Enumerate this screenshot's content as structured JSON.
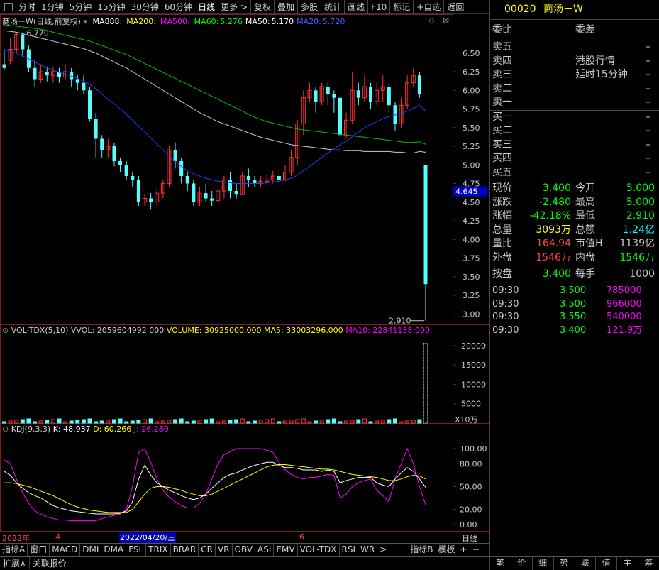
{
  "toolbar": {
    "items": [
      "分时",
      "1分钟",
      "5分钟",
      "15分钟",
      "30分钟",
      "60分钟",
      "日线",
      "更多 >",
      "复权",
      "叠加",
      "多股",
      "统计",
      "画线",
      "F10",
      "标记",
      "+自选",
      "返回"
    ],
    "active": "日线"
  },
  "main_chart": {
    "stock_label": "商汤－W",
    "adj_label": "(日线,前复权)",
    "ma": [
      {
        "name": "MA888:",
        "value": "",
        "color": "#ffffff"
      },
      {
        "name": "MA200:",
        "value": "",
        "color": "#ffff00"
      },
      {
        "name": "MA500:",
        "value": "",
        "color": "#ff00ff"
      },
      {
        "name": "MA60:",
        "value": "5.276",
        "color": "#00ff00"
      },
      {
        "name": "MA50:",
        "value": "5.170",
        "color": "#ffffff"
      },
      {
        "name": "MA20:",
        "value": "5.720",
        "color": "#4060ff"
      }
    ],
    "high_label": "6.770",
    "low_label": "2.910",
    "cur_label": "4.645",
    "y_ticks": [
      "6.50",
      "6.25",
      "6.00",
      "5.75",
      "5.50",
      "5.25",
      "5.00",
      "4.75",
      "4.50",
      "4.25",
      "4.00",
      "3.75",
      "3.50",
      "3.25",
      "3.00"
    ]
  },
  "volume": {
    "legend_name": "VOL-TDX(5,10)",
    "vvol": "VVOL: 2059604992.000",
    "volume": "VOLUME: 30925000.000",
    "ma5": "MA5: 33003296.000",
    "ma10": "MA10: 22841138.000",
    "y_ticks": [
      "20000",
      "15000",
      "10000",
      "5000"
    ],
    "unit": "X10万"
  },
  "kdj": {
    "name": "KDJ(9,3,3)",
    "k": "K: 48.937",
    "d": "D: 60.266",
    "j": "J: 26.280",
    "y_ticks": [
      "100.00",
      "80.00",
      "50.00",
      "20.00",
      "0.00"
    ]
  },
  "x_axis": {
    "labels": [
      "2022年",
      "4",
      "2022/04/20/三",
      "6"
    ],
    "period": "日线"
  },
  "tabs": [
    "指标A",
    "窗口",
    "MACD",
    "DMI",
    "DMA",
    "FSL",
    "TRIX",
    "BRAR",
    "CR",
    "VR",
    "OBV",
    "ASI",
    "EMV",
    "VOL-TDX",
    "RSI",
    "WR",
    ">",
    "指标B",
    "模板",
    "+",
    "−"
  ],
  "status": [
    "扩展∧",
    "关联报价"
  ],
  "right_panel": {
    "code": "00020",
    "name": "商汤－W",
    "weibi_label": "委比",
    "weicha_label": "委差",
    "sell": [
      {
        "label": "卖五",
        "value": "–"
      },
      {
        "label": "卖四",
        "value": "–",
        "note": "港股行情"
      },
      {
        "label": "卖三",
        "value": "–",
        "note": "延时15分钟"
      },
      {
        "label": "卖二",
        "value": "–"
      },
      {
        "label": "卖一",
        "value": "–"
      }
    ],
    "buy": [
      {
        "label": "买一",
        "value": "–"
      },
      {
        "label": "买二",
        "value": "–"
      },
      {
        "label": "买三",
        "value": "–"
      },
      {
        "label": "买四",
        "value": "–"
      },
      {
        "label": "买五",
        "value": "–"
      }
    ],
    "quote": [
      {
        "k1": "现价",
        "v1": "3.400",
        "c1": "#00ff00",
        "k2": "今开",
        "v2": "5.000",
        "c2": "#00ff00"
      },
      {
        "k1": "涨跌",
        "v1": "-2.480",
        "c1": "#00ff00",
        "k2": "最高",
        "v2": "5.000",
        "c2": "#00ff00"
      },
      {
        "k1": "涨幅",
        "v1": "-42.18%",
        "c1": "#00ff00",
        "k2": "最低",
        "v2": "2.910",
        "c2": "#00ff00"
      },
      {
        "k1": "总量",
        "v1": "3093万",
        "c1": "#ffff00",
        "k2": "总额",
        "v2": "1.24亿",
        "c2": "#00ffff"
      },
      {
        "k1": "量比",
        "v1": "164.94",
        "c1": "#ff4040",
        "k2": "市值H",
        "v2": "1139亿",
        "c2": "#c8c8c8"
      },
      {
        "k1": "外盘",
        "v1": "1546万",
        "c1": "#ff4040",
        "k2": "内盘",
        "v2": "1546万",
        "c2": "#00ff00"
      }
    ],
    "anpan": {
      "k1": "按盘",
      "v1": "3.400",
      "k2": "每手",
      "v2": "1000"
    },
    "trades": [
      {
        "time": "09:30",
        "price": "3.500",
        "vol": "785000"
      },
      {
        "time": "09:30",
        "price": "3.500",
        "vol": "966000"
      },
      {
        "time": "09:30",
        "price": "3.550",
        "vol": "540000"
      },
      {
        "time": "09:30",
        "price": "3.400",
        "vol": "121.9万"
      }
    ],
    "bottom_tabs": [
      "笔",
      "价",
      "细",
      "势",
      "联",
      "值",
      "主",
      "筹"
    ]
  },
  "chart_data": {
    "type": "candlestick",
    "ylim": [
      2.85,
      6.85
    ],
    "candles": [
      [
        6.35,
        6.3,
        6.55,
        6.28
      ],
      [
        6.4,
        6.55,
        6.7,
        6.35
      ],
      [
        6.55,
        6.75,
        6.77,
        6.5
      ],
      [
        6.75,
        6.55,
        6.77,
        6.45
      ],
      [
        6.55,
        6.3,
        6.6,
        6.25
      ],
      [
        6.3,
        6.15,
        6.4,
        6.05
      ],
      [
        6.15,
        6.25,
        6.35,
        6.1
      ],
      [
        6.25,
        6.2,
        6.32,
        6.12
      ],
      [
        6.2,
        6.25,
        6.32,
        6.1
      ],
      [
        6.25,
        6.18,
        6.3,
        6.1
      ],
      [
        6.18,
        6.25,
        6.35,
        6.15
      ],
      [
        6.25,
        6.15,
        6.3,
        6.05
      ],
      [
        6.15,
        6.1,
        6.2,
        6.0
      ],
      [
        6.1,
        6.0,
        6.2,
        5.95
      ],
      [
        6.0,
        5.62,
        6.05,
        5.58
      ],
      [
        5.62,
        5.35,
        5.7,
        5.1
      ],
      [
        5.35,
        5.2,
        5.4,
        5.1
      ],
      [
        5.2,
        5.25,
        5.35,
        5.1
      ],
      [
        5.25,
        5.05,
        5.3,
        4.98
      ],
      [
        5.05,
        5.0,
        5.1,
        4.9
      ],
      [
        5.0,
        4.85,
        5.05,
        4.8
      ],
      [
        4.85,
        4.8,
        4.9,
        4.7
      ],
      [
        4.8,
        4.5,
        4.85,
        4.45
      ],
      [
        4.5,
        4.55,
        4.6,
        4.45
      ],
      [
        4.55,
        4.5,
        4.62,
        4.4
      ],
      [
        4.5,
        4.62,
        4.7,
        4.45
      ],
      [
        4.62,
        4.75,
        4.8,
        4.55
      ],
      [
        4.75,
        5.2,
        5.25,
        4.7
      ],
      [
        5.2,
        5.05,
        5.3,
        4.95
      ],
      [
        5.05,
        4.85,
        5.1,
        4.75
      ],
      [
        4.85,
        4.75,
        4.9,
        4.65
      ],
      [
        4.75,
        4.5,
        4.8,
        4.45
      ],
      [
        4.5,
        4.62,
        4.7,
        4.45
      ],
      [
        4.62,
        4.55,
        4.75,
        4.5
      ],
      [
        4.55,
        4.52,
        4.65,
        4.45
      ],
      [
        4.52,
        4.65,
        4.72,
        4.5
      ],
      [
        4.65,
        4.8,
        4.85,
        4.55
      ],
      [
        4.8,
        4.65,
        4.9,
        4.55
      ],
      [
        4.65,
        4.6,
        4.75,
        4.55
      ],
      [
        4.6,
        4.85,
        4.9,
        4.6
      ],
      [
        4.85,
        4.8,
        4.95,
        4.7
      ],
      [
        4.8,
        4.75,
        4.85,
        4.7
      ],
      [
        4.75,
        4.78,
        4.85,
        4.7
      ],
      [
        4.78,
        4.8,
        4.88,
        4.72
      ],
      [
        4.8,
        4.85,
        4.92,
        4.75
      ],
      [
        4.85,
        4.8,
        4.95,
        4.75
      ],
      [
        4.8,
        4.9,
        5.0,
        4.78
      ],
      [
        4.9,
        5.1,
        5.2,
        4.85
      ],
      [
        5.1,
        5.55,
        5.6,
        5.0
      ],
      [
        5.55,
        5.9,
        6.0,
        5.4
      ],
      [
        5.9,
        6.0,
        6.1,
        5.85
      ],
      [
        6.0,
        5.85,
        6.05,
        5.7
      ],
      [
        5.85,
        6.05,
        6.1,
        5.8
      ],
      [
        6.05,
        5.95,
        6.1,
        5.8
      ],
      [
        5.95,
        5.9,
        6.0,
        5.7
      ],
      [
        5.9,
        5.4,
        5.95,
        5.35
      ],
      [
        5.4,
        5.6,
        5.7,
        5.35
      ],
      [
        5.6,
        6.0,
        6.25,
        5.55
      ],
      [
        6.0,
        5.9,
        6.1,
        5.8
      ],
      [
        5.9,
        6.05,
        6.2,
        5.85
      ],
      [
        6.05,
        5.85,
        6.1,
        5.75
      ],
      [
        5.85,
        6.0,
        6.1,
        5.8
      ],
      [
        6.0,
        6.05,
        6.2,
        5.85
      ],
      [
        6.05,
        5.8,
        6.1,
        5.7
      ],
      [
        5.8,
        5.55,
        5.85,
        5.45
      ],
      [
        5.55,
        5.8,
        5.9,
        5.5
      ],
      [
        5.8,
        6.1,
        6.2,
        5.75
      ],
      [
        6.1,
        6.2,
        6.3,
        6.05
      ],
      [
        6.2,
        5.95,
        6.25,
        5.9
      ],
      [
        5.0,
        3.4,
        5.0,
        2.91
      ]
    ],
    "ma20": [
      6.55,
      6.52,
      6.5,
      6.46,
      6.42,
      6.38,
      6.34,
      6.3,
      6.27,
      6.24,
      6.22,
      6.19,
      6.16,
      6.12,
      6.08,
      6.02,
      5.95,
      5.88,
      5.82,
      5.75,
      5.68,
      5.6,
      5.52,
      5.44,
      5.36,
      5.28,
      5.2,
      5.12,
      5.05,
      4.98,
      4.92,
      4.88,
      4.85,
      4.82,
      4.8,
      4.78,
      4.77,
      4.76,
      4.75,
      4.75,
      4.75,
      4.75,
      4.75,
      4.76,
      4.77,
      4.78,
      4.8,
      4.82,
      4.86,
      4.92,
      4.98,
      5.04,
      5.1,
      5.16,
      5.22,
      5.27,
      5.32,
      5.38,
      5.44,
      5.5,
      5.54,
      5.58,
      5.62,
      5.65,
      5.67,
      5.69,
      5.72,
      5.76,
      5.8,
      5.72
    ],
    "ma50": [
      6.8,
      6.79,
      6.78,
      6.76,
      6.74,
      6.72,
      6.7,
      6.68,
      6.66,
      6.64,
      6.62,
      6.6,
      6.58,
      6.56,
      6.53,
      6.5,
      6.46,
      6.42,
      6.38,
      6.34,
      6.3,
      6.25,
      6.2,
      6.15,
      6.1,
      6.05,
      6.0,
      5.95,
      5.9,
      5.85,
      5.8,
      5.75,
      5.7,
      5.66,
      5.62,
      5.58,
      5.55,
      5.52,
      5.49,
      5.46,
      5.43,
      5.4,
      5.37,
      5.35,
      5.33,
      5.31,
      5.29,
      5.27,
      5.26,
      5.25,
      5.24,
      5.23,
      5.22,
      5.21,
      5.2,
      5.2,
      5.19,
      5.19,
      5.19,
      5.18,
      5.18,
      5.18,
      5.18,
      5.18,
      5.17,
      5.17,
      5.16,
      5.16,
      5.18,
      5.17
    ],
    "ma60": [
      6.88,
      6.87,
      6.86,
      6.85,
      6.84,
      6.83,
      6.82,
      6.8,
      6.78,
      6.76,
      6.74,
      6.72,
      6.7,
      6.68,
      6.66,
      6.63,
      6.6,
      6.57,
      6.54,
      6.51,
      6.48,
      6.44,
      6.4,
      6.36,
      6.32,
      6.28,
      6.24,
      6.2,
      6.16,
      6.12,
      6.08,
      6.04,
      6.0,
      5.96,
      5.92,
      5.88,
      5.84,
      5.8,
      5.76,
      5.72,
      5.68,
      5.64,
      5.61,
      5.58,
      5.56,
      5.54,
      5.52,
      5.5,
      5.48,
      5.47,
      5.46,
      5.45,
      5.44,
      5.43,
      5.42,
      5.41,
      5.4,
      5.39,
      5.38,
      5.37,
      5.36,
      5.35,
      5.34,
      5.33,
      5.32,
      5.31,
      5.3,
      5.3,
      5.31,
      5.276
    ],
    "kdj_k": [
      70,
      65,
      55,
      48,
      42,
      38,
      35,
      30,
      25,
      22,
      20,
      18,
      17,
      16,
      15,
      14,
      14,
      14,
      14,
      15,
      18,
      30,
      60,
      78,
      65,
      55,
      50,
      45,
      42,
      38,
      35,
      33,
      35,
      40,
      48,
      55,
      62,
      66,
      68,
      72,
      75,
      78,
      80,
      82,
      82,
      78,
      75,
      75,
      74,
      72,
      72,
      72,
      70,
      72,
      70,
      55,
      58,
      60,
      62,
      62,
      62,
      55,
      52,
      50,
      60,
      68,
      75,
      70,
      60,
      49
    ],
    "kdj_d": [
      55,
      55,
      54,
      52,
      50,
      47,
      44,
      41,
      38,
      34,
      30,
      26,
      23,
      21,
      19,
      18,
      17,
      16,
      16,
      16,
      16,
      20,
      30,
      40,
      48,
      50,
      50,
      49,
      47,
      45,
      42,
      40,
      38,
      38,
      40,
      44,
      48,
      52,
      56,
      60,
      64,
      68,
      72,
      76,
      78,
      79,
      79,
      78,
      77,
      76,
      75,
      74,
      73,
      73,
      72,
      70,
      68,
      66,
      65,
      64,
      63,
      62,
      60,
      58,
      58,
      60,
      63,
      65,
      64,
      60
    ],
    "kdj_j": [
      85,
      80,
      60,
      42,
      28,
      18,
      14,
      10,
      8,
      6,
      6,
      5,
      5,
      5,
      5,
      5,
      8,
      10,
      12,
      14,
      20,
      50,
      95,
      100,
      82,
      60,
      45,
      36,
      30,
      25,
      22,
      22,
      28,
      40,
      60,
      80,
      92,
      96,
      100,
      100,
      100,
      100,
      100,
      98,
      95,
      82,
      72,
      66,
      62,
      60,
      62,
      62,
      64,
      66,
      65,
      35,
      40,
      50,
      55,
      58,
      60,
      45,
      38,
      30,
      60,
      80,
      100,
      80,
      50,
      26
    ]
  }
}
